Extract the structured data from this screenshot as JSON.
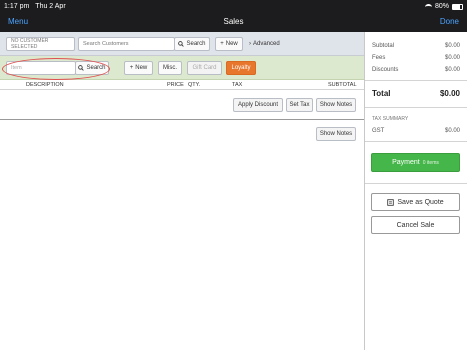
{
  "status_bar": {
    "time": "1:17 pm",
    "date": "Thu 2 Apr",
    "battery": "80%"
  },
  "nav": {
    "menu": "Menu",
    "title": "Sales",
    "done": "Done"
  },
  "customer_bar": {
    "selected": "NO CUSTOMER SELECTED",
    "search_placeholder": "Search Customers",
    "search_button": "Search",
    "new_button": "New",
    "advanced_link": "Advanced"
  },
  "item_bar": {
    "item_placeholder": "Item",
    "search_button": "Search",
    "new_button": "New",
    "misc_button": "Misc.",
    "gift_card_button": "Gift Card",
    "loyalty_button": "Loyalty"
  },
  "table": {
    "headers": {
      "description": "DESCRIPTION",
      "price": "PRICE",
      "qty": "QTY.",
      "tax": "TAX",
      "subtotal": "SUBTOTAL"
    }
  },
  "actions": {
    "apply_discount": "Apply Discount",
    "set_tax": "Set Tax",
    "show_notes": "Show Notes",
    "show_notes_2": "Show Notes"
  },
  "summary": {
    "subtotal_label": "Subtotal",
    "subtotal_value": "$0.00",
    "fees_label": "Fees",
    "fees_value": "$0.00",
    "discounts_label": "Discounts",
    "discounts_value": "$0.00",
    "total_label": "Total",
    "total_value": "$0.00",
    "tax_summary_label": "TAX SUMMARY",
    "gst_label": "GST",
    "gst_value": "$0.00"
  },
  "buttons": {
    "payment": "Payment",
    "payment_count": "0 items",
    "save_quote": "Save as Quote",
    "cancel_sale": "Cancel Sale"
  },
  "colors": {
    "accent_blue": "#4aa3ff",
    "loyalty_orange": "#e8772e",
    "payment_green": "#45b649"
  }
}
